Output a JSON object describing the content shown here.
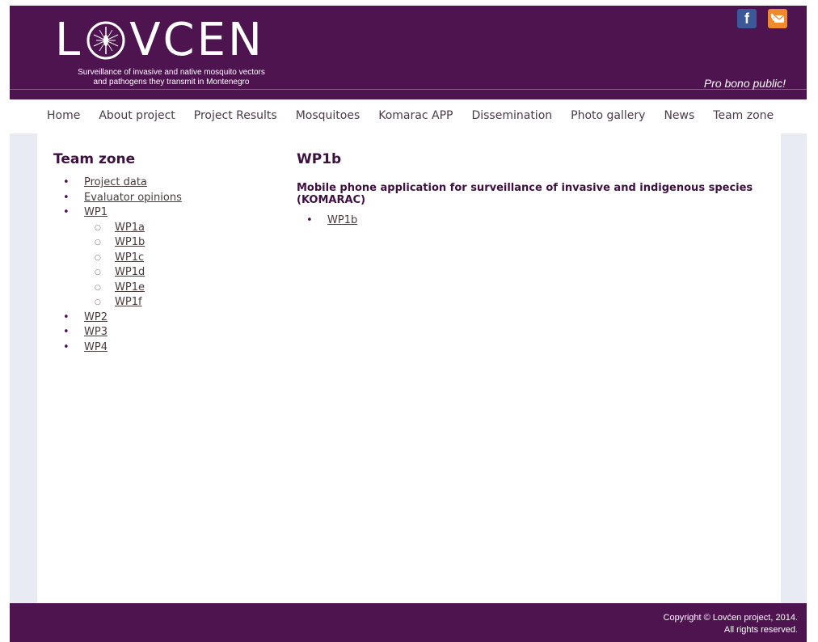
{
  "header": {
    "logo_left": "L",
    "logo_right": "VCEN",
    "tagline_line1": "Surveillance of invasive and native mosquito vectors",
    "tagline_line2": "and pathogens they transmit in Montenegro",
    "motto": "Pro bono public!",
    "facebook_glyph": "f",
    "icons": [
      "facebook-icon",
      "contact-phone-icon"
    ]
  },
  "nav": {
    "items": [
      "Home",
      "About project",
      "Project Results",
      "Mosquitoes",
      "Komarac APP",
      "Dissemination",
      "Photo gallery",
      "News",
      "Team zone"
    ]
  },
  "sidebar": {
    "title": "Team zone",
    "items": {
      "project_data": "Project data",
      "evaluator_opinions": "Evaluator opinions",
      "wp1": "WP1",
      "wp1_sub": [
        "WP1a",
        "WP1b",
        "WP1c",
        "WP1d",
        "WP1e",
        "WP1f"
      ],
      "wp2": "WP2",
      "wp3": "WP3",
      "wp4": "WP4"
    }
  },
  "article": {
    "title": "WP1b",
    "subtitle": "Mobile phone application for surveillance of invasive and indigenous species (KOMARAC)",
    "links": [
      "WP1b"
    ]
  },
  "footer": {
    "copyright_line1": "Copyright © Lovćen project, 2014.",
    "copyright_line2": "All rights reserved."
  },
  "colors": {
    "brand_purple": "#4d1450",
    "side_gutter": "#e8ecf2",
    "facebook_blue": "#3b5998",
    "contact_orange": "#f08a2c"
  }
}
